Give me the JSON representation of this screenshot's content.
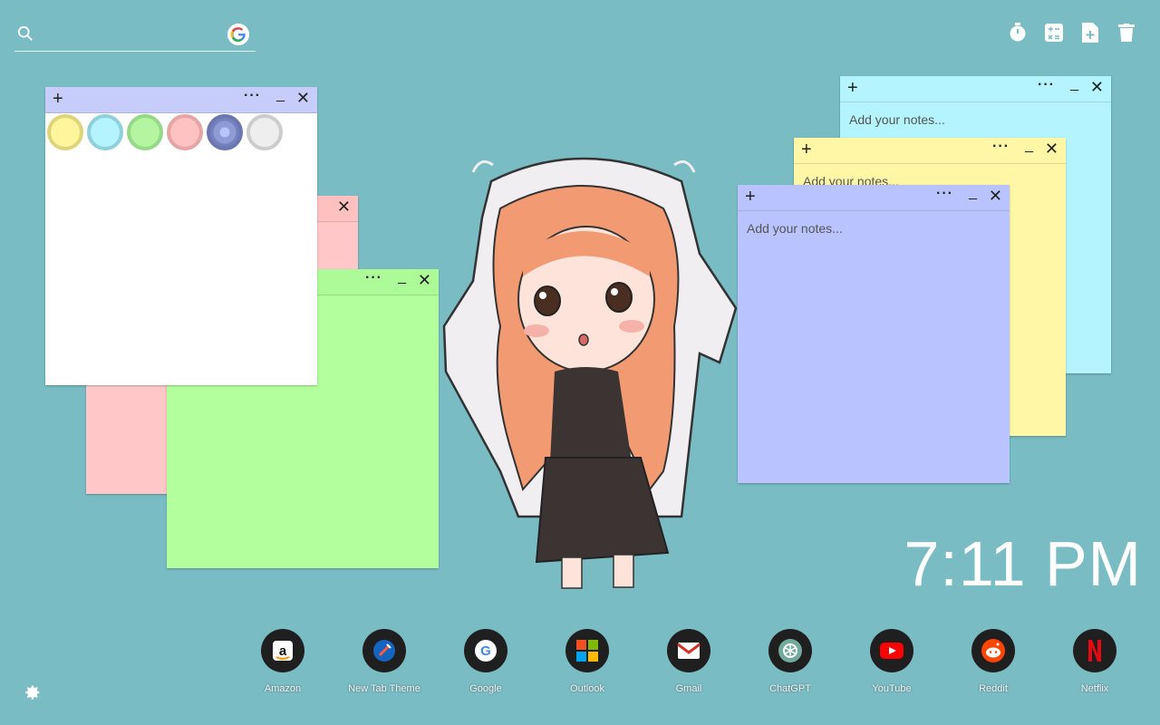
{
  "search": {
    "placeholder": ""
  },
  "tools": [
    "timer-icon",
    "calculator-icon",
    "add-note-icon",
    "trash-icon"
  ],
  "notes": {
    "white": {
      "color": "#ffffff",
      "bar_color": "#c7cdfb",
      "close": "✕",
      "more": "···",
      "min": "_",
      "plus": "+"
    },
    "pink": {
      "color": "#ffc7c7",
      "bar_color": "#ffb7b7",
      "more": "···",
      "min": "_",
      "close": "✕"
    },
    "green": {
      "color": "#b3ff9e",
      "bar_color": "#a6f792",
      "more": "···",
      "min": "_",
      "close": "✕"
    },
    "cyan": {
      "color": "#b3f4ff",
      "placeholder": "Add your notes...",
      "plus": "+",
      "more": "···",
      "min": "_",
      "close": "✕"
    },
    "yellow": {
      "color": "#fff7a6",
      "placeholder": "Add your notes...",
      "plus": "+",
      "more": "···",
      "min": "_",
      "close": "✕"
    },
    "blue": {
      "color": "#b9c4ff",
      "placeholder": "Add your notes...",
      "plus": "+",
      "more": "···",
      "min": "_",
      "close": "✕"
    }
  },
  "palette": [
    {
      "name": "yellow",
      "fill": "#fff59d",
      "ring": "#e0d47a"
    },
    {
      "name": "cyan",
      "fill": "#b3f4ff",
      "ring": "#8fd0dc"
    },
    {
      "name": "green",
      "fill": "#b5f5a2",
      "ring": "#93d987"
    },
    {
      "name": "pink",
      "fill": "#ffc2c2",
      "ring": "#e6a4a4"
    },
    {
      "name": "blue",
      "fill": "#8e9bd4",
      "ring": "#6b77b0",
      "selected": true
    },
    {
      "name": "gray",
      "fill": "#eeeeee",
      "ring": "#cccccc"
    }
  ],
  "clock": {
    "time": "7:11 PM"
  },
  "dock": [
    {
      "label": "Amazon",
      "icon": "amazon-icon"
    },
    {
      "label": "New Tab Theme",
      "icon": "new-tab-theme-icon"
    },
    {
      "label": "Google",
      "icon": "google-icon"
    },
    {
      "label": "Outlook",
      "icon": "outlook-icon"
    },
    {
      "label": "Gmail",
      "icon": "gmail-icon"
    },
    {
      "label": "ChatGPT",
      "icon": "chatgpt-icon"
    },
    {
      "label": "YouTube",
      "icon": "youtube-icon"
    },
    {
      "label": "Reddit",
      "icon": "reddit-icon"
    },
    {
      "label": "Netflix",
      "icon": "netflix-icon"
    }
  ],
  "colors": {
    "background": "#79bcc4",
    "clock": "#ffffff"
  }
}
